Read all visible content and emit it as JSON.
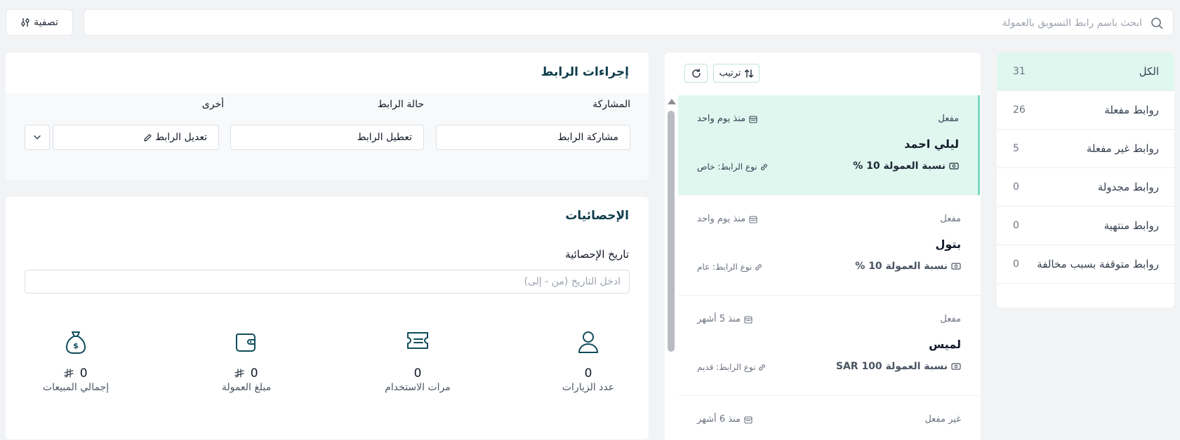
{
  "topbar": {
    "search_placeholder": "ابحث باسم رابط التسويق بالعمولة",
    "filter_label": "تصفية"
  },
  "categories": [
    {
      "label": "الكل",
      "count": "31",
      "active": true
    },
    {
      "label": "روابط مفعلة",
      "count": "26"
    },
    {
      "label": "روابط غير مفعلة",
      "count": "5"
    },
    {
      "label": "روابط مجدولة",
      "count": "0"
    },
    {
      "label": "روابط منتهية",
      "count": "0"
    },
    {
      "label": "روابط متوقفة بسبب مخالفة",
      "count": "0"
    }
  ],
  "list": {
    "sort_label": "ترتيب",
    "items": [
      {
        "status": "مفعل",
        "since": "منذ يوم واحد",
        "name": "ليلي احمد",
        "commission": "نسبة العمولة 10 %",
        "link_type": "نوع الرابط: خاص"
      },
      {
        "status": "مفعل",
        "since": "منذ يوم واحد",
        "name": "بتول",
        "commission": "نسبة العمولة 10 %",
        "link_type": "نوع الرابط: عام"
      },
      {
        "status": "مفعل",
        "since": "منذ 5 أشهر",
        "name": "لميس",
        "commission": "نسبة العمولة 100 SAR",
        "link_type": "نوع الرابط: قديم"
      },
      {
        "status": "غير مفعل",
        "since": "منذ 6 أشهر",
        "name": "",
        "commission": "",
        "link_type": ""
      }
    ]
  },
  "actions": {
    "title": "إجراءات الرابط",
    "share_label": "المشاركة",
    "share_value": "مشاركة الرابط",
    "status_label": "حالة الرابط",
    "status_value": "تعطيل الرابط",
    "other_label": "أخرى",
    "other_value": "تعديل الرابط"
  },
  "stats": {
    "title": "الإحصائيات",
    "date_label": "تاريخ الإحصائية",
    "date_placeholder": "ادخل التاريخ (من - إلى)",
    "visits_value": "0",
    "visits_label": "عدد الزيارات",
    "uses_value": "0",
    "uses_label": "مرات الاستخدام",
    "commission_value": "0",
    "commission_label": "مبلغ العمولة",
    "sales_value": "0",
    "sales_label": "إجمالي المبيعات"
  },
  "colors": {
    "accent": "#dff7ef",
    "heading": "#0f3d4c",
    "icon": "#0f4c5c"
  }
}
